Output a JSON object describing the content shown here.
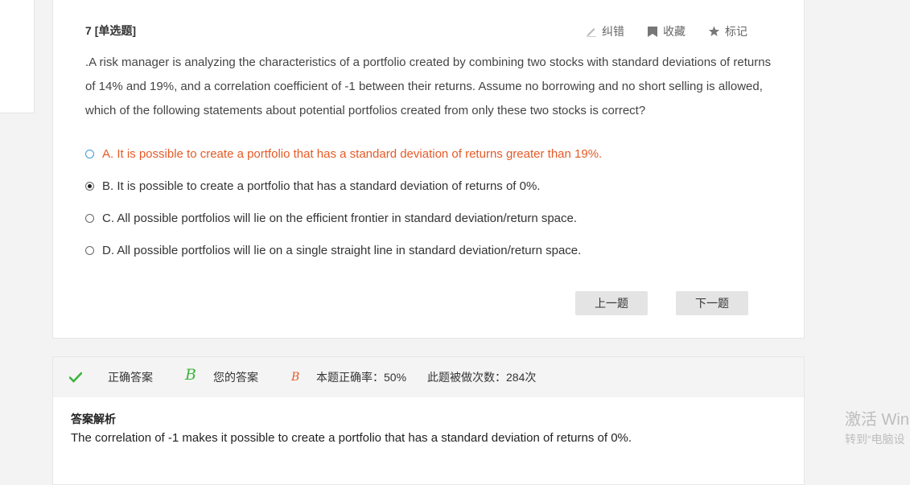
{
  "question": {
    "number": "7",
    "type": "[单选题]",
    "text": ".A risk manager is analyzing the characteristics of a portfolio created by combining two stocks with standard deviations of returns of 14% and 19%, and a correlation coefficient of -1 between their returns. Assume no borrowing and no short selling is allowed, which of the following statements about potential portfolios created from only these two stocks is correct?"
  },
  "tools": {
    "report": "纠错",
    "favorite": "收藏",
    "mark": "标记"
  },
  "options": [
    {
      "label": "A. It is possible to create a portfolio that has a standard deviation of returns greater than 19%."
    },
    {
      "label": "B. It is possible to create a portfolio that has a standard deviation of returns of 0%."
    },
    {
      "label": "C. All possible portfolios will lie on the efficient frontier in standard deviation/return space."
    },
    {
      "label": "D. All possible portfolios will lie on a single straight line in standard deviation/return space."
    }
  ],
  "navigation": {
    "prev": "上一题",
    "next": "下一题"
  },
  "answer": {
    "correct_label": "正确答案",
    "correct_value": "B",
    "your_label": "您的答案",
    "your_value": "B",
    "accuracy": "本题正确率：50%",
    "attempts": "此题被做次数：284次",
    "analysis_title": "答案解析",
    "analysis_text": "The correlation of -1 makes it possible to create a portfolio that has a standard deviation of returns of 0%."
  },
  "watermark": {
    "line1": "激活 Win",
    "line2": "转到“电脑设"
  },
  "colors": {
    "correct_green": "#3cb53c",
    "your_answer_orange": "#e65a26",
    "selected_hint_blue": "#3a9bd8"
  }
}
